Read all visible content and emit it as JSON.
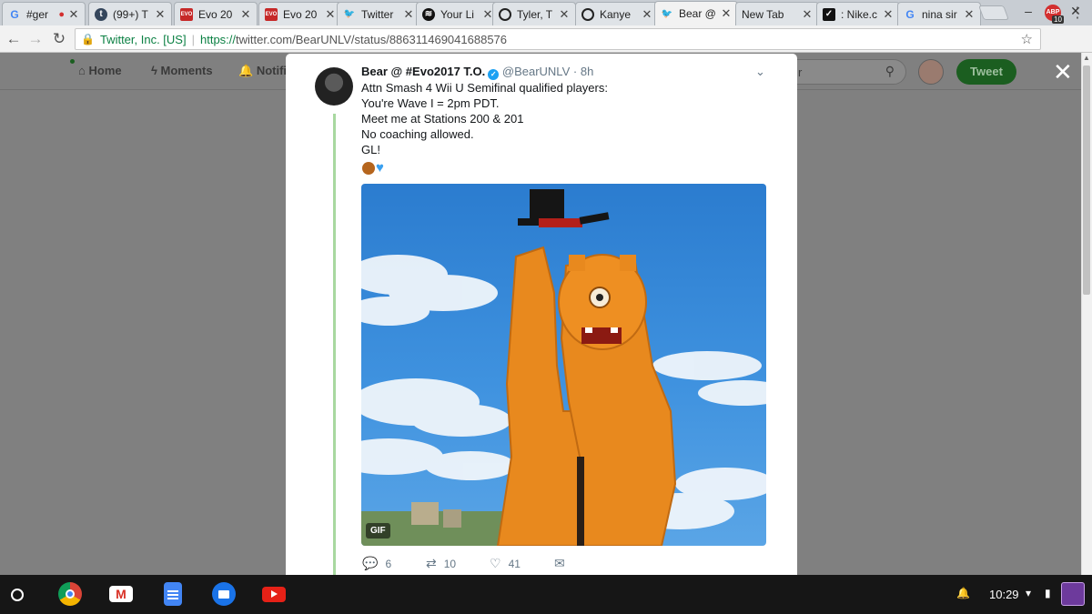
{
  "browser": {
    "tabs": [
      {
        "title": "#ger",
        "favicon": "G",
        "fav_color": "#4285f4",
        "recording": true
      },
      {
        "title": "(99+) T",
        "favicon": "t",
        "fav_color": "#35465c"
      },
      {
        "title": "Evo 20",
        "favicon": "EVO",
        "fav_color": "#c62828"
      },
      {
        "title": "Evo 20",
        "favicon": "EVO",
        "fav_color": "#c62828"
      },
      {
        "title": "Twitter",
        "favicon": "bird",
        "fav_color": "#1da1f2"
      },
      {
        "title": "Your Li",
        "favicon": "spotify",
        "fav_color": "#1db954"
      },
      {
        "title": "Tyler, T",
        "favicon": "ring",
        "fav_color": "#222222"
      },
      {
        "title": "Kanye",
        "favicon": "ring",
        "fav_color": "#222222"
      },
      {
        "title": "Bear @",
        "favicon": "bird",
        "fav_color": "#1da1f2",
        "active": true
      },
      {
        "title": "New Tab",
        "favicon": "",
        "fav_color": ""
      },
      {
        "title": ": Nike.c",
        "favicon": "N",
        "fav_color": "#111111"
      },
      {
        "title": "nina sir",
        "favicon": "G",
        "fav_color": "#4285f4"
      }
    ],
    "address": {
      "ev_name": "Twitter, Inc. [US]",
      "separator": "|",
      "protocol": "https://",
      "url_rest": "twitter.com/BearUNLV/status/886311469041688576"
    },
    "extension_badge": "10",
    "extension_label": "ABP"
  },
  "twitter_header": {
    "nav": [
      {
        "label": "Home",
        "icon": "home-icon"
      },
      {
        "label": "Moments",
        "icon": "lightning-icon"
      },
      {
        "label": "Notifi",
        "icon": "bell-icon"
      }
    ],
    "search_placeholder_fragment": "r",
    "tweet_button": "Tweet"
  },
  "tweet": {
    "display_name": "Bear @ #Evo2017 T.O.",
    "handle": "@BearUNLV",
    "dot": "·",
    "time": "8h",
    "lines": [
      "Attn Smash 4 Wii U Semifinal qualified players:",
      "You're Wave I = 2pm PDT.",
      "Meet me at Stations 200 & 201",
      "No coaching allowed.",
      "GL!"
    ],
    "media_label": "GIF",
    "actions": {
      "replies": "6",
      "retweets": "10",
      "likes": "41"
    }
  },
  "shelf": {
    "time": "10:29"
  }
}
